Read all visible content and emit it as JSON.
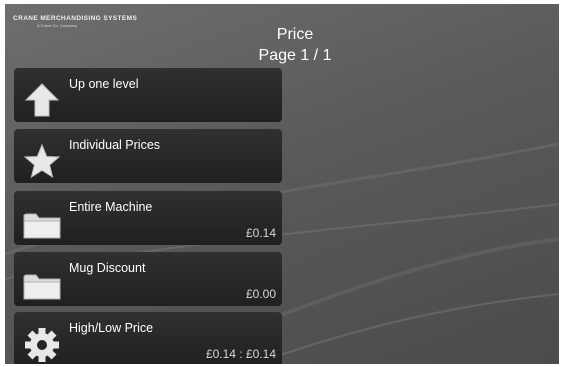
{
  "brand": {
    "name": "CRANE  MERCHANDISING SYSTEMS",
    "tagline": "A Crane Co. Company"
  },
  "header": {
    "title": "Price",
    "page": "Page 1 / 1"
  },
  "menu": {
    "items": [
      {
        "label": "Up one level",
        "value": "",
        "icon": "up-arrow-icon"
      },
      {
        "label": "Individual Prices",
        "value": "",
        "icon": "star-icon"
      },
      {
        "label": "Entire Machine",
        "value": "£0.14",
        "icon": "folder-icon"
      },
      {
        "label": "Mug Discount",
        "value": "£0.00",
        "icon": "folder-icon"
      },
      {
        "label": "High/Low Price",
        "value": "£0.14 : £0.14",
        "icon": "gear-icon"
      }
    ]
  },
  "colors": {
    "background": "#5a5a5a",
    "button": "#262626",
    "text": "#ffffff",
    "icon": "#e6e6e6"
  }
}
